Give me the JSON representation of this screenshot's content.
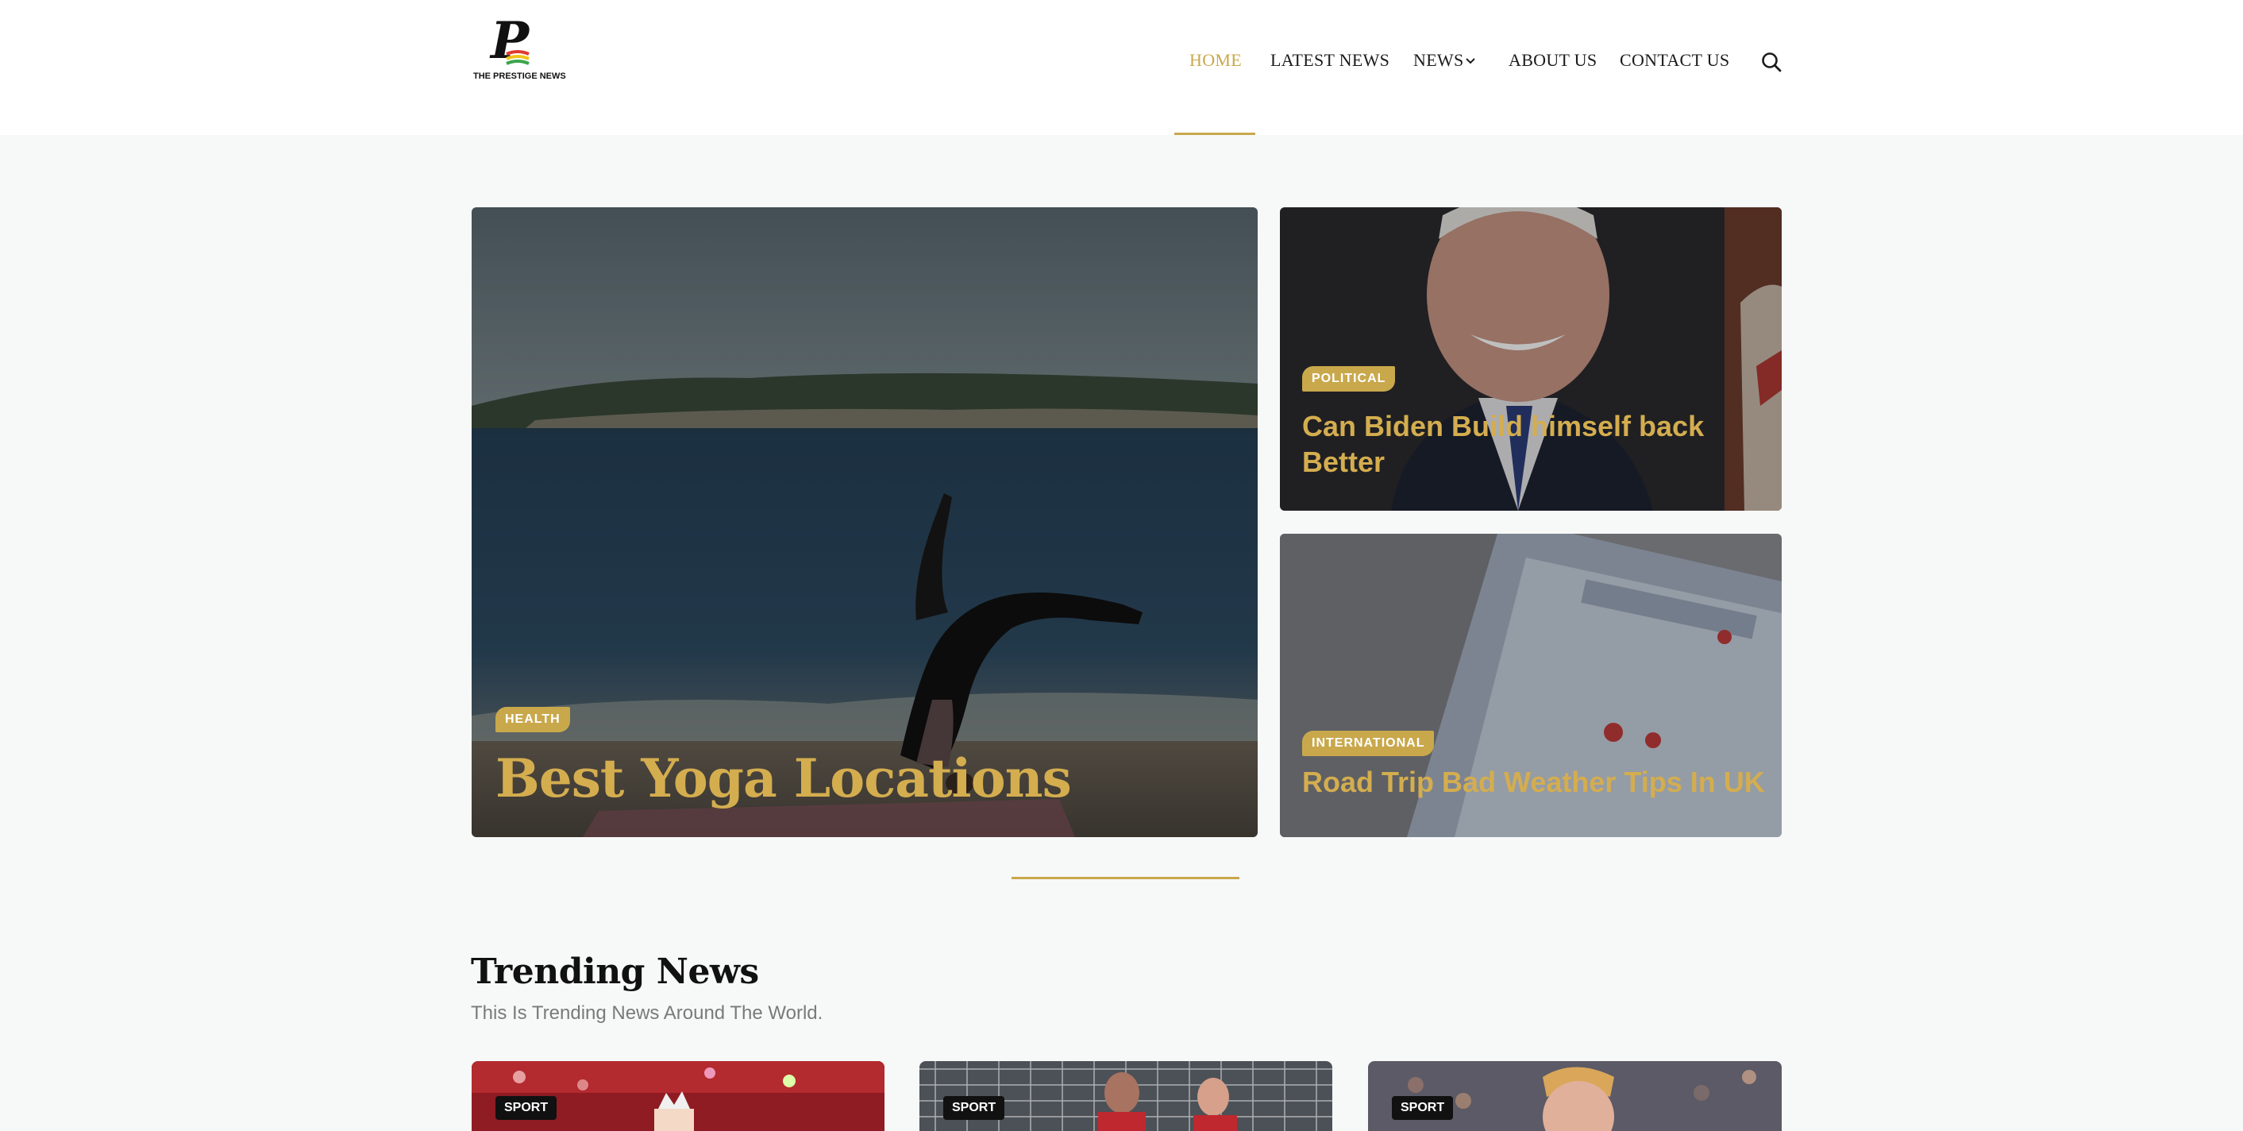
{
  "header": {
    "logo_text": "THE PRESTIGE NEWS",
    "nav": {
      "home": "HOME",
      "latest": "LATEST NEWS",
      "news": "NEWS",
      "about": "ABOUT US",
      "contact": "CONTACT US"
    },
    "icons": {
      "search": "search-icon",
      "dropdown": "chevron-down-icon"
    },
    "accent_color": "#c9a84c"
  },
  "hero": {
    "main": {
      "category": "HEALTH",
      "title": "Best Yoga Locations"
    },
    "side_top": {
      "category": "POLITICAL",
      "title_line1": "Can Biden Build himself back",
      "title_line2": "Better"
    },
    "side_bottom": {
      "category": "INTERNATIONAL",
      "title": "Road Trip Bad Weather Tips In UK"
    }
  },
  "trending": {
    "title": "Trending News",
    "subtitle": "This Is Trending News Around The World.",
    "cards": [
      {
        "category": "SPORT"
      },
      {
        "category": "SPORT"
      },
      {
        "category": "SPORT"
      }
    ]
  }
}
